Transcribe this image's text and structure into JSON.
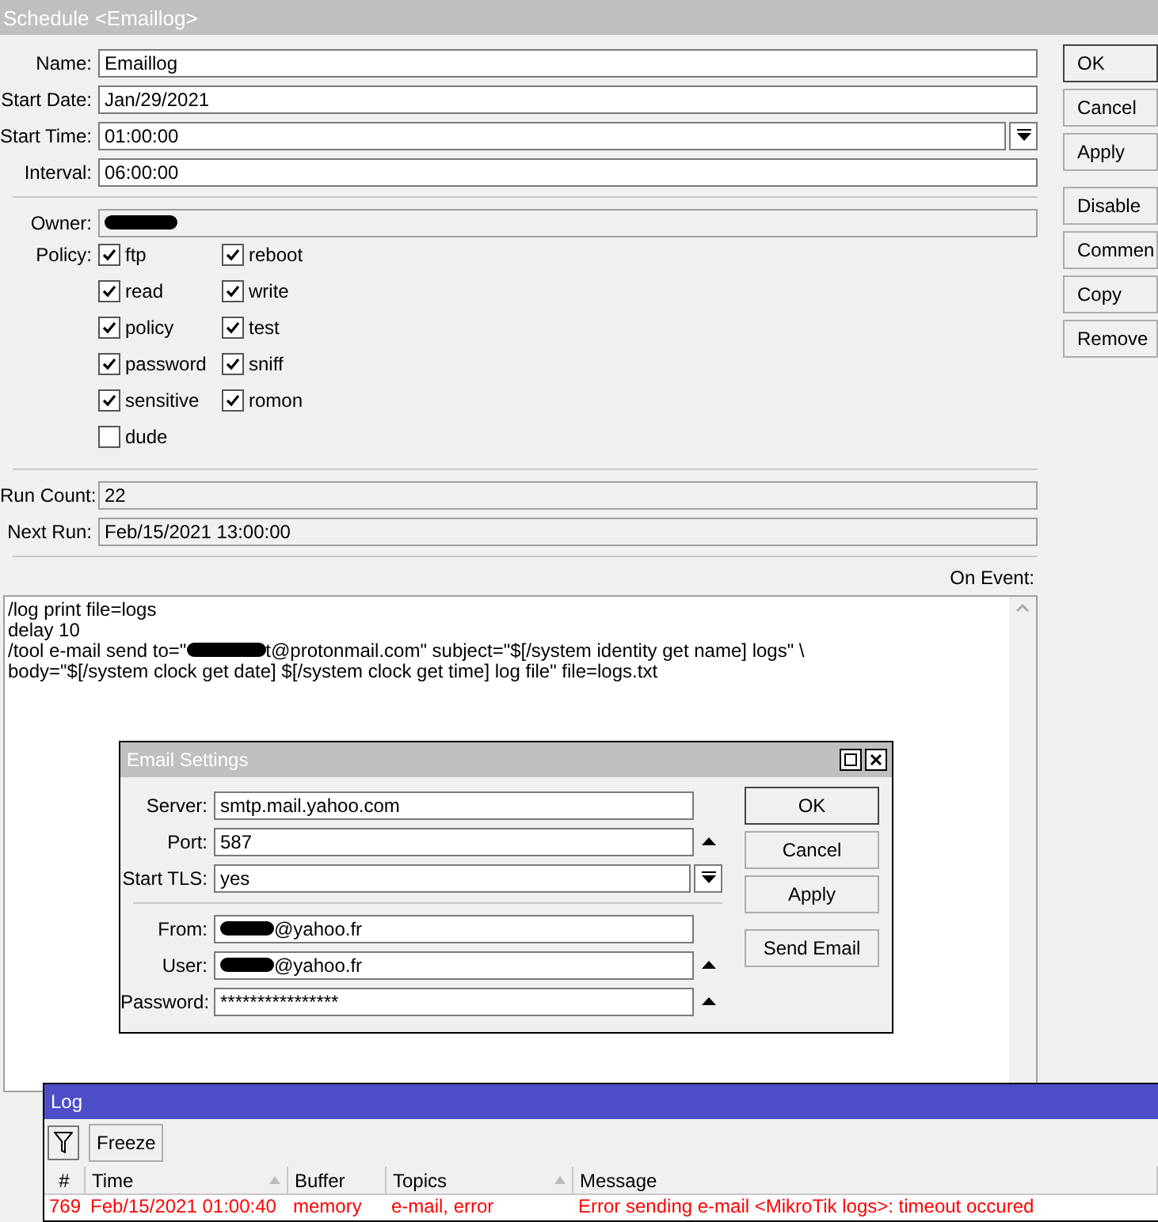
{
  "window": {
    "title": "Schedule <Emaillog>"
  },
  "fields": [
    {
      "label": "Name:",
      "value": "Emaillog",
      "kind": "text"
    },
    {
      "label": "Start Date:",
      "value": "Jan/29/2021",
      "kind": "text"
    },
    {
      "label": "Start Time:",
      "value": "01:00:00",
      "kind": "dropdown"
    },
    {
      "label": "Interval:",
      "value": "06:00:00",
      "kind": "text"
    }
  ],
  "owner": {
    "label": "Owner:",
    "redacted": true
  },
  "policy": {
    "label": "Policy:",
    "columns": [
      [
        {
          "label": "ftp",
          "checked": true
        },
        {
          "label": "read",
          "checked": true
        },
        {
          "label": "policy",
          "checked": true
        },
        {
          "label": "password",
          "checked": true
        },
        {
          "label": "sensitive",
          "checked": true
        },
        {
          "label": "dude",
          "checked": false
        }
      ],
      [
        {
          "label": "reboot",
          "checked": true
        },
        {
          "label": "write",
          "checked": true
        },
        {
          "label": "test",
          "checked": true
        },
        {
          "label": "sniff",
          "checked": true
        },
        {
          "label": "romon",
          "checked": true
        }
      ]
    ]
  },
  "status": [
    {
      "label": "Run Count:",
      "value": "22"
    },
    {
      "label": "Next Run:",
      "value": "Feb/15/2021 13:00:00"
    }
  ],
  "on_event": {
    "label": "On Event:",
    "lines": [
      {
        "text": "/log print file=logs"
      },
      {
        "text": "delay 10"
      },
      {
        "text": "/tool e-mail send to=\"",
        "redacted_after": "t@protonmail.com\" subject=\"$[/system identity get name]  logs\" \\"
      },
      {
        "text": "body=\"$[/system clock get date] $[/system clock get time] log file\" file=logs.txt"
      }
    ]
  },
  "buttons": [
    {
      "label": "OK",
      "default": true
    },
    {
      "label": "Cancel",
      "default": false
    },
    {
      "label": "Apply",
      "default": false
    },
    {
      "label": "Disable",
      "default": false
    },
    {
      "label": "Commen",
      "default": false
    },
    {
      "label": "Copy",
      "default": false
    },
    {
      "label": "Remove",
      "default": false
    }
  ],
  "email_settings": {
    "title": "Email Settings",
    "groups": [
      [
        {
          "label": "Server:",
          "value": "smtp.mail.yahoo.com",
          "kind": "text",
          "redacted": false
        },
        {
          "label": "Port:",
          "value": "587",
          "kind": "spin",
          "redacted": false
        },
        {
          "label": "Start TLS:",
          "value": "yes",
          "kind": "dropdown",
          "redacted": false
        }
      ],
      [
        {
          "label": "From:",
          "value": "@yahoo.fr",
          "kind": "text",
          "redacted": true
        },
        {
          "label": "User:",
          "value": "@yahoo.fr",
          "kind": "spin",
          "redacted": true
        },
        {
          "label": "Password:",
          "value": "****************",
          "kind": "spin",
          "redacted": false
        }
      ]
    ],
    "buttons": [
      {
        "label": "OK",
        "default": true
      },
      {
        "label": "Cancel",
        "default": false
      },
      {
        "label": "Apply",
        "default": false
      },
      {
        "label": "Send Email",
        "default": false
      }
    ]
  },
  "log": {
    "title": "Log",
    "freeze": "Freeze",
    "columns": [
      {
        "label": "#",
        "sorted": false
      },
      {
        "label": "Time",
        "sorted": true
      },
      {
        "label": "Buffer",
        "sorted": false
      },
      {
        "label": "Topics",
        "sorted": true
      },
      {
        "label": "Message",
        "sorted": false
      }
    ],
    "rows": [
      {
        "cells": [
          "769",
          "Feb/15/2021 01:00:40",
          "memory",
          "e-mail, error",
          "Error sending e-mail <MikroTik  logs>: timeout occured"
        ],
        "color": "#ff0000"
      }
    ]
  }
}
